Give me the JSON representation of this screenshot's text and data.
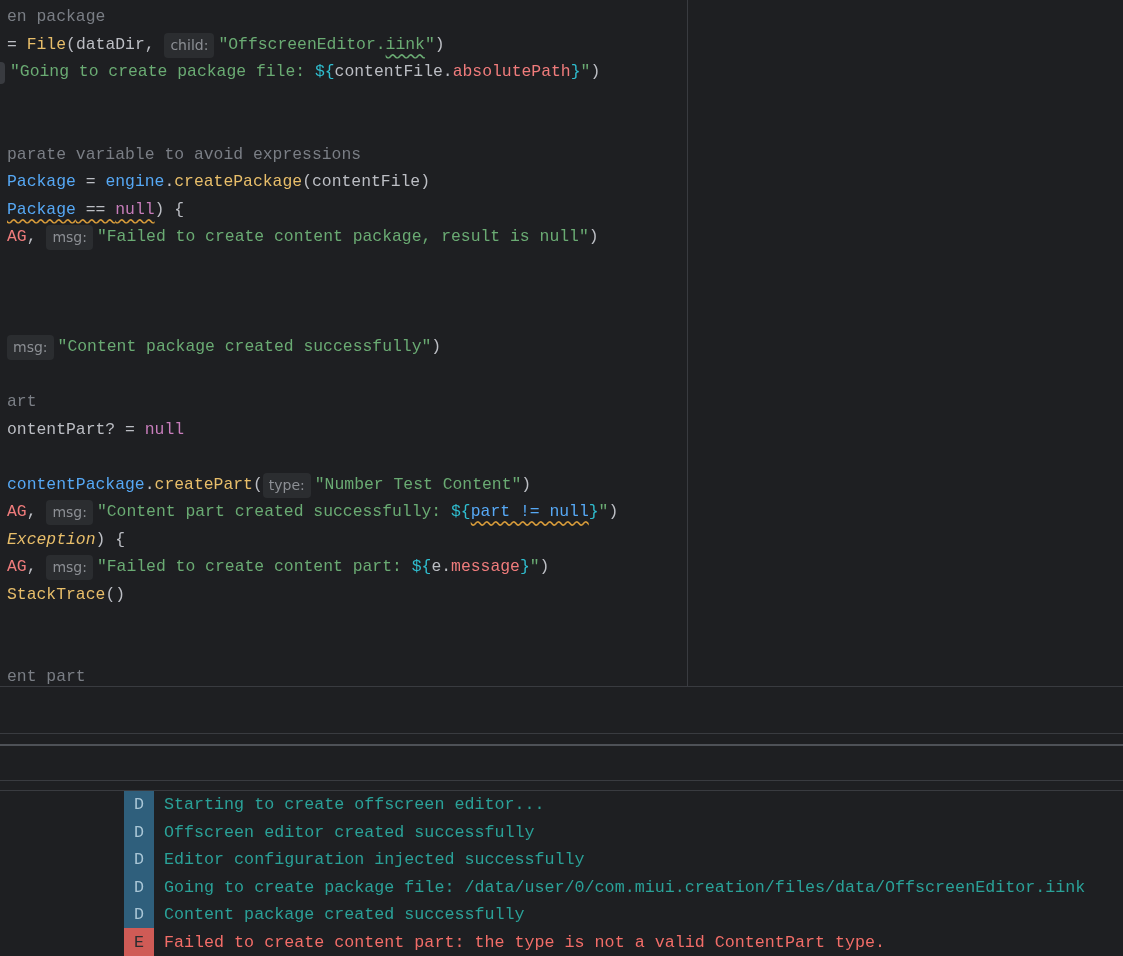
{
  "editor": {
    "lines": [
      {
        "kind": "code",
        "tokens": [
          {
            "text": "en package",
            "kind": "comment"
          }
        ]
      },
      {
        "kind": "code",
        "tokens": [
          {
            "text": "= ",
            "kind": "plain"
          },
          {
            "text": "File",
            "kind": "function"
          },
          {
            "text": "(dataDir, ",
            "kind": "plain"
          },
          {
            "text": "child:",
            "kind": "hint"
          },
          {
            "text": "\"OffscreenEditor.",
            "kind": "string"
          },
          {
            "text": "iink",
            "kind": "string",
            "misspelled": true
          },
          {
            "text": "\"",
            "kind": "string"
          },
          {
            "text": ")",
            "kind": "plain"
          }
        ]
      },
      {
        "kind": "code",
        "tokens": [
          {
            "text": "\"Going to create package file: ",
            "kind": "string"
          },
          {
            "text": "${",
            "kind": "template"
          },
          {
            "text": "contentFile.",
            "kind": "plain"
          },
          {
            "text": "absolutePath",
            "kind": "property"
          },
          {
            "text": "}",
            "kind": "template"
          },
          {
            "text": "\"",
            "kind": "string"
          },
          {
            "text": ")",
            "kind": "plain"
          }
        ],
        "cut_hint": true
      },
      {
        "kind": "blank"
      },
      {
        "kind": "blank"
      },
      {
        "kind": "code",
        "tokens": [
          {
            "text": "parate variable to avoid expressions",
            "kind": "comment"
          }
        ]
      },
      {
        "kind": "code",
        "tokens": [
          {
            "text": "Package",
            "kind": "variable"
          },
          {
            "text": " = ",
            "kind": "plain"
          },
          {
            "text": "engine",
            "kind": "variable"
          },
          {
            "text": ".",
            "kind": "plain"
          },
          {
            "text": "createPackage",
            "kind": "function"
          },
          {
            "text": "(contentFile)",
            "kind": "plain"
          }
        ]
      },
      {
        "kind": "code",
        "tokens": [
          {
            "text": "Package",
            "kind": "variable",
            "warning": true
          },
          {
            "text": " == ",
            "kind": "plain",
            "warning": true
          },
          {
            "text": "null",
            "kind": "keyword",
            "warning": true
          },
          {
            "text": ") {",
            "kind": "plain"
          }
        ]
      },
      {
        "kind": "code",
        "tokens": [
          {
            "text": "AG",
            "kind": "property"
          },
          {
            "text": ", ",
            "kind": "plain"
          },
          {
            "text": "msg:",
            "kind": "hint"
          },
          {
            "text": "\"Failed to create content package, result is null\"",
            "kind": "string"
          },
          {
            "text": ")",
            "kind": "plain"
          }
        ]
      },
      {
        "kind": "blank"
      },
      {
        "kind": "blank"
      },
      {
        "kind": "blank"
      },
      {
        "kind": "code",
        "tokens": [
          {
            "text": "msg:",
            "kind": "hint"
          },
          {
            "text": "\"Content package created successfully\"",
            "kind": "string"
          },
          {
            "text": ")",
            "kind": "plain"
          }
        ]
      },
      {
        "kind": "blank"
      },
      {
        "kind": "code",
        "tokens": [
          {
            "text": "art",
            "kind": "comment"
          }
        ]
      },
      {
        "kind": "code",
        "tokens": [
          {
            "text": "ontentPart? = ",
            "kind": "plain"
          },
          {
            "text": "null",
            "kind": "keyword"
          }
        ]
      },
      {
        "kind": "blank"
      },
      {
        "kind": "code",
        "tokens": [
          {
            "text": "contentPackage",
            "kind": "variable"
          },
          {
            "text": ".",
            "kind": "plain"
          },
          {
            "text": "createPart",
            "kind": "function"
          },
          {
            "text": "(",
            "kind": "plain"
          },
          {
            "text": "type:",
            "kind": "hint"
          },
          {
            "text": "\"Number Test Content\"",
            "kind": "string"
          },
          {
            "text": ")",
            "kind": "plain"
          }
        ]
      },
      {
        "kind": "code",
        "tokens": [
          {
            "text": "AG",
            "kind": "property"
          },
          {
            "text": ", ",
            "kind": "plain"
          },
          {
            "text": "msg:",
            "kind": "hint"
          },
          {
            "text": "\"Content part created successfully: ",
            "kind": "string"
          },
          {
            "text": "${",
            "kind": "template"
          },
          {
            "text": "part != null",
            "kind": "variable",
            "warning": true
          },
          {
            "text": "}",
            "kind": "template"
          },
          {
            "text": "\"",
            "kind": "string"
          },
          {
            "text": ")",
            "kind": "plain"
          }
        ]
      },
      {
        "kind": "code",
        "tokens": [
          {
            "text": "Exception",
            "kind": "type"
          },
          {
            "text": ") {",
            "kind": "plain"
          }
        ]
      },
      {
        "kind": "code",
        "tokens": [
          {
            "text": "AG",
            "kind": "property"
          },
          {
            "text": ", ",
            "kind": "plain"
          },
          {
            "text": "msg:",
            "kind": "hint"
          },
          {
            "text": "\"Failed to create content part: ",
            "kind": "string"
          },
          {
            "text": "${",
            "kind": "template"
          },
          {
            "text": "e.",
            "kind": "plain"
          },
          {
            "text": "message",
            "kind": "property"
          },
          {
            "text": "}",
            "kind": "template"
          },
          {
            "text": "\"",
            "kind": "string"
          },
          {
            "text": ")",
            "kind": "plain"
          }
        ]
      },
      {
        "kind": "code",
        "tokens": [
          {
            "text": "StackTrace",
            "kind": "function"
          },
          {
            "text": "()",
            "kind": "plain"
          }
        ]
      },
      {
        "kind": "blank"
      },
      {
        "kind": "blank"
      },
      {
        "kind": "code",
        "tokens": [
          {
            "text": "ent part",
            "kind": "comment"
          }
        ]
      }
    ]
  },
  "logcat": {
    "rows": [
      {
        "level": "D",
        "message": "Starting to create offscreen editor..."
      },
      {
        "level": "D",
        "message": "Offscreen editor created successfully"
      },
      {
        "level": "D",
        "message": "Editor configuration injected successfully"
      },
      {
        "level": "D",
        "message": "Going to create package file: /data/user/0/com.miui.creation/files/data/OffscreenEditor.iink"
      },
      {
        "level": "D",
        "message": "Content package created successfully"
      },
      {
        "level": "E",
        "message": "Failed to create content part: the type is not a valid ContentPart type."
      }
    ]
  }
}
